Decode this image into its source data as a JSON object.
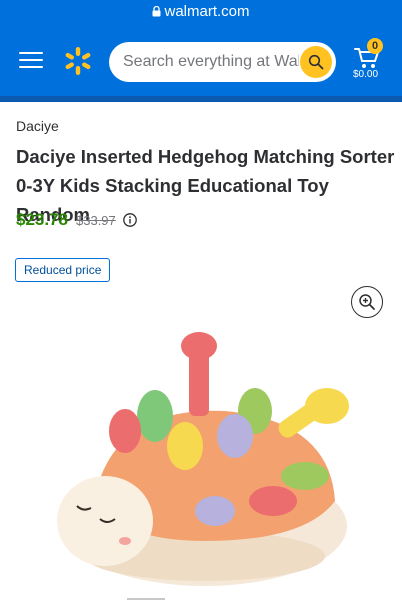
{
  "browser": {
    "url": "walmart.com"
  },
  "header": {
    "search_placeholder": "Search everything at Walmart online and in store",
    "cart": {
      "count": "0",
      "total": "$0.00"
    }
  },
  "product": {
    "brand": "Daciye",
    "title": "Daciye Inserted Hedgehog Matching Sorter 0-3Y Kids Stacking Educational Toy Random",
    "price": "$23.78",
    "was_price": "$33.97",
    "badge": "Reduced price"
  },
  "icons": {
    "lock": "lock-icon",
    "menu": "menu-icon",
    "logo": "walmart-spark-logo",
    "search": "search-icon",
    "cart": "cart-icon",
    "info": "info-icon",
    "zoom": "zoom-in-icon"
  },
  "colors": {
    "header_blue": "#0071dc",
    "spark_yellow": "#ffc220",
    "price_green": "#2a8703",
    "badge_blue": "#004f9a"
  }
}
